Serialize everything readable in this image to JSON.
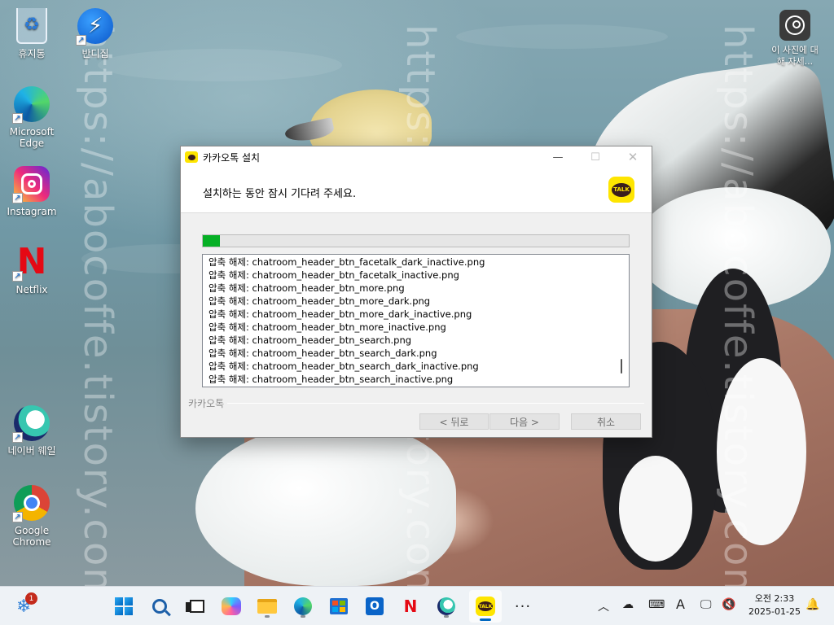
{
  "desktop": {
    "icons": [
      {
        "label": "휴지통",
        "icon": "recycle-bin-icon"
      },
      {
        "label": "반디집",
        "icon": "bandizip-icon"
      },
      {
        "label": "Microsoft Edge",
        "icon": "edge-icon"
      },
      {
        "label": "Instagram",
        "icon": "instagram-icon"
      },
      {
        "label": "Netflix",
        "icon": "netflix-icon"
      },
      {
        "label": "네이버 웨일",
        "icon": "whale-icon"
      },
      {
        "label": "Google Chrome",
        "icon": "chrome-icon"
      },
      {
        "label": "이 사진에 대해 자세...",
        "icon": "about-picture-icon"
      }
    ],
    "watermark": "https://abocoffe.tistory.com/"
  },
  "installer": {
    "title": "카카오톡 설치",
    "header_message": "설치하는 동안 잠시 기다려 주세요.",
    "logo_text": "TALK",
    "progress_fraction": 0.04,
    "progress_color": "#06b025",
    "log_lines": [
      "압축 해제: chatroom_header_btn_facetalk_dark_inactive.png",
      "압축 해제: chatroom_header_btn_facetalk_inactive.png",
      "압축 해제: chatroom_header_btn_more.png",
      "압축 해제: chatroom_header_btn_more_dark.png",
      "압축 해제: chatroom_header_btn_more_dark_inactive.png",
      "압축 해제: chatroom_header_btn_more_inactive.png",
      "압축 해제: chatroom_header_btn_search.png",
      "압축 해제: chatroom_header_btn_search_dark.png",
      "압축 해제: chatroom_header_btn_search_dark_inactive.png",
      "압축 해제: chatroom_header_btn_search_inactive.png"
    ],
    "brand_label": "카카오톡",
    "buttons": {
      "back": "< 뒤로",
      "next": "다음 >",
      "cancel": "취소"
    }
  },
  "taskbar": {
    "weather_badge": "1",
    "tb_netflix": "N",
    "outlook_letter": "O",
    "kakao_text": "TALK",
    "more": "···",
    "tray": {
      "chevron": "︿",
      "ime": "A"
    },
    "clock": {
      "time": "오전 2:33",
      "date": "2025-01-25"
    }
  }
}
